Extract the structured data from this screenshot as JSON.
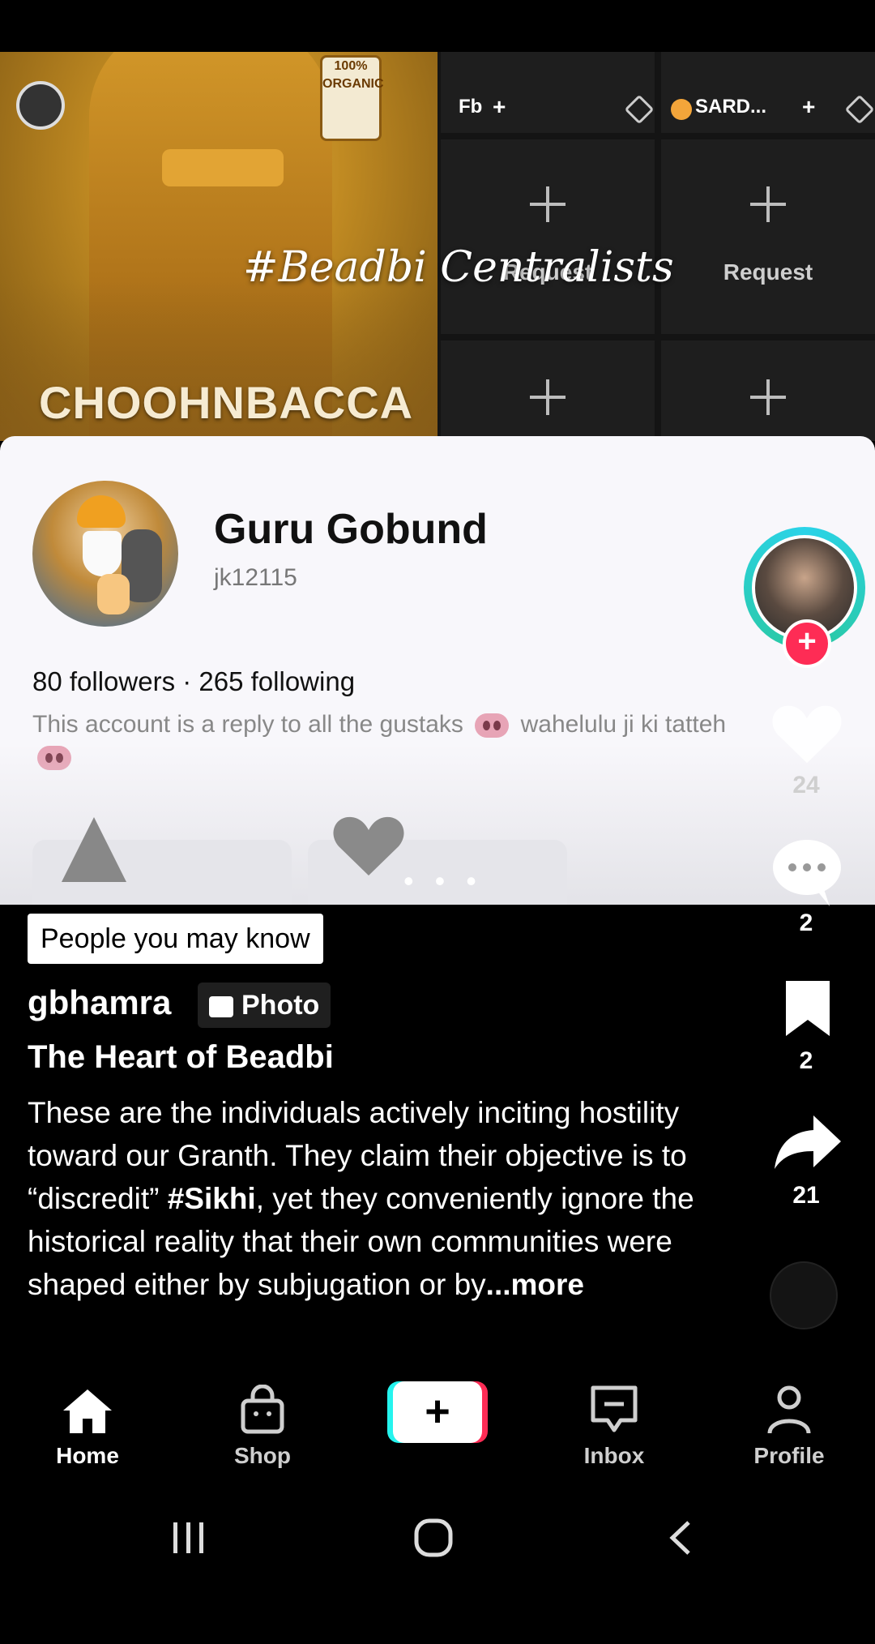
{
  "video": {
    "hero_title": "CHOOHNBACCA",
    "bottle_label": "100% ORGANIC",
    "overlay_hashtag": "#Beadbi Centralists",
    "live_tiles": [
      {
        "label": "Fb"
      },
      {
        "label": "SARD..."
      }
    ],
    "request_label": "Request"
  },
  "profile_card": {
    "name": "Guru Gobund",
    "username": "jk12115",
    "stats": "80 followers · 265 following",
    "bio_part1": "This account is a reply to all the gustaks",
    "bio_part2": "wahelulu ji ki tatteh"
  },
  "rail": {
    "like_count": "24",
    "comment_count": "2",
    "save_count": "2",
    "share_count": "21"
  },
  "caption": {
    "badge": "People you may know",
    "author": "gbhamra",
    "type_chip": "Photo",
    "title": "The Heart of Beadbi",
    "desc_1": "These are the individuals actively inciting hostility toward our Granth. They claim their objective is to “discredit” ",
    "desc_tag": "#Sikhi",
    "desc_2": ", yet they conveniently ignore the historical reality that their own communities were shaped either by subjugation or by",
    "desc_more": "...more"
  },
  "nav": {
    "home": "Home",
    "shop": "Shop",
    "create": "+",
    "inbox": "Inbox",
    "profile": "Profile"
  },
  "colors": {
    "accent_pink": "#fe2c55",
    "accent_cyan": "#25f4ee",
    "ring": "#2bd3e8"
  }
}
